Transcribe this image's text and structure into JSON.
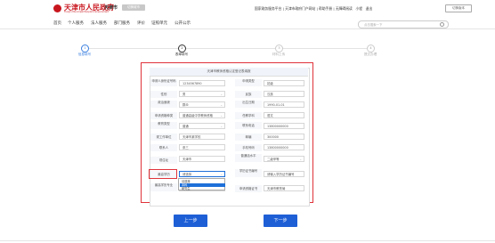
{
  "header": {
    "site_title": "天津市人民政府",
    "site_subtitle": "Tianjin Municipal People's Government",
    "city": "天津市",
    "city_selector": "切换城市",
    "top_links": [
      "国家政务服务平台",
      "天津市政府门户网站",
      "帮助手册",
      "无障碍阅读",
      "小程",
      "退出"
    ],
    "lang_button": "切换版本"
  },
  "nav": {
    "items": [
      "首页",
      "个人服务",
      "法人服务",
      "部门服务",
      "评价",
      "证照单元",
      "公开公示"
    ],
    "search_placeholder": "点击搜索一下"
  },
  "steps": [
    {
      "num": "1",
      "label": "信息填写",
      "state": "done"
    },
    {
      "num": "2",
      "label": "表单填写",
      "state": "active"
    },
    {
      "num": "3",
      "label": "材料上传",
      "state": "todo"
    },
    {
      "num": "4",
      "label": "提交办理",
      "state": "todo"
    }
  ],
  "form": {
    "title": "天津市教师资格认定登记表填报",
    "rows": [
      {
        "l1": "申请人身份证号码",
        "v1": "1234567890",
        "l2": "申请类型",
        "v2": "初级"
      },
      {
        "l1": "性别",
        "v1": "男",
        "l2": "民族",
        "v2": "汉族"
      },
      {
        "l1": "政治面貌",
        "v1": "群众",
        "l2": "出生日期",
        "v2": "1990-01-01"
      },
      {
        "l1": "申请资格种类",
        "v1": "普通高级中学教师资格",
        "l2": "任教学科",
        "v2": "语文"
      },
      {
        "l1": "教育类型",
        "v1": "普通",
        "l2": "联系电话",
        "v2": "13800000000"
      },
      {
        "l1": "现工作单位",
        "v1": "天津市某学校",
        "l2": "邮编",
        "v2": "300000"
      },
      {
        "l1": "联系人",
        "v1": "张三",
        "l2": "手机号码",
        "v2": "13800000000"
      },
      {
        "l1": "现住址",
        "v1": "天津市",
        "l2": "普通话水平",
        "v2": "二级甲等"
      },
      {
        "l1": "最高学历",
        "v1": "请选择",
        "l2": "学历证书编号",
        "v2": "请输入学历证书编号"
      },
      {
        "l1": "最高学历专业",
        "v1": "",
        "l2": "申请资格证书",
        "v2": "天津市教育局"
      }
    ],
    "dropdown_options": [
      "请选择",
      "本科",
      "研究生"
    ],
    "dropdown_selected_index": 1
  },
  "buttons": {
    "prev": "上一步",
    "next": "下一步"
  },
  "colors": {
    "brand_red": "#c8161e",
    "accent_blue": "#1e5fd6",
    "highlight_red": "#e0333a"
  }
}
